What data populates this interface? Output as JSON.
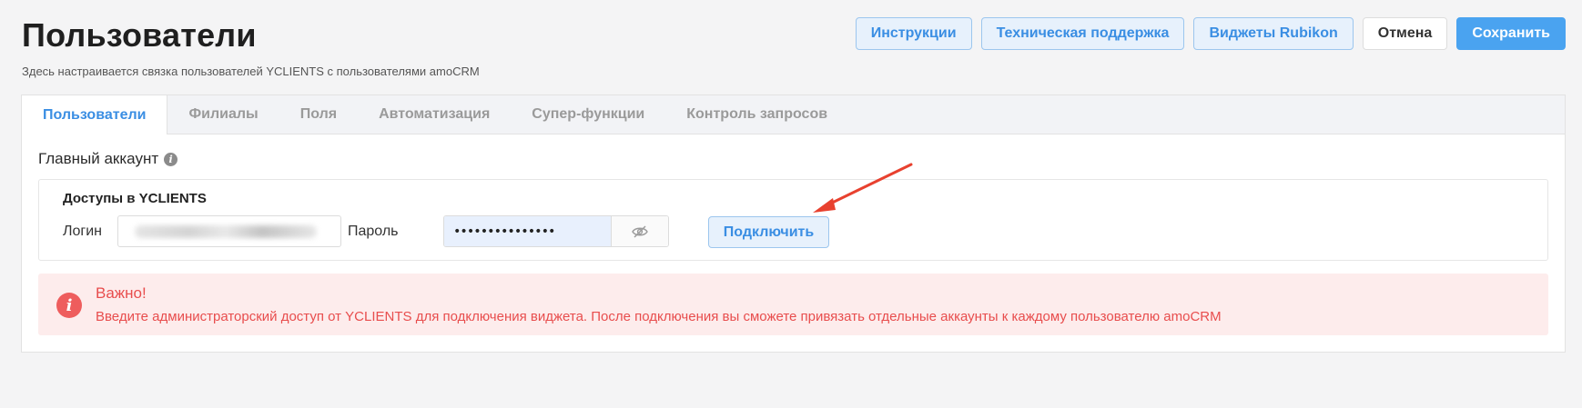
{
  "header": {
    "title": "Пользователи",
    "subtitle": "Здесь настраивается связка пользователей YCLIENTS с пользователями amoCRM",
    "buttons": {
      "instructions": "Инструкции",
      "support": "Техническая поддержка",
      "widgets": "Виджеты Rubikon",
      "cancel": "Отмена",
      "save": "Сохранить"
    }
  },
  "tabs": [
    {
      "label": "Пользователи",
      "active": true
    },
    {
      "label": "Филиалы",
      "active": false
    },
    {
      "label": "Поля",
      "active": false
    },
    {
      "label": "Автоматизация",
      "active": false
    },
    {
      "label": "Супер-функции",
      "active": false
    },
    {
      "label": "Контроль запросов",
      "active": false
    }
  ],
  "main_account": {
    "title": "Главный аккаунт",
    "info_icon": "info-icon"
  },
  "access": {
    "title": "Доступы в YCLIENTS",
    "login_label": "Логин",
    "password_label": "Пароль",
    "password_value": "•••••••••••••••",
    "eye_icon": "eye-slash-icon",
    "connect_label": "Подключить"
  },
  "alert": {
    "title": "Важно!",
    "text": "Введите администраторский доступ от YCLIENTS для подключения виджета. После подключения вы сможете привязать отдельные аккаунты к каждому пользователю amoCRM",
    "color": "#e84d4d",
    "background": "#fdecec"
  },
  "colors": {
    "accent": "#4aa3f0",
    "accent_text": "#3a8ee3",
    "annotation_arrow": "#e8412f"
  }
}
